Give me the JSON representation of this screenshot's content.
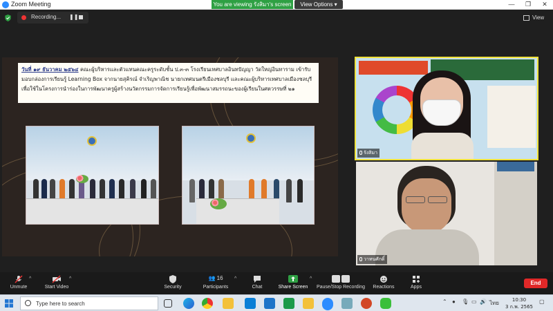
{
  "window": {
    "title": "Zoom Meeting",
    "viewing_banner": "You are viewing รังสิมา's screen",
    "view_options": "View Options",
    "minimize": "—",
    "maximize": "❐",
    "close": "✕"
  },
  "recording": {
    "label": "Recording...",
    "pause": "❚❚"
  },
  "view_button": "View",
  "slide": {
    "date": "วันที่ ๑๙ ธันวาคม ๒๕๖๔",
    "body": " คณะผู้บริหารและตัวแทนคณะครูระดับชั้น ป.๓-๓ โรงเรียนเทศบาลอินทปัญญา วัดใหญ่อินทาราม เข้ารับมอบกล่องการเรียนรู้ Learning Box จากนายสุคิรณ์ จำเริญพาณิช นายกเทศมนตรีเมืองชลบุรี และคณะผู้บริหารเทศบาลเมืองชลบุรี เพื่อใช้ในโครงการนำร่องในการพัฒนาครูผู้สร้างนวัตกรรมการจัดการเรียนรู้เพื่อพัฒนาสมรรถนะของผู้เรียนในศตวรรษที่ ๒๑"
  },
  "participants": [
    {
      "name": "รังสิมา"
    },
    {
      "name": "วาทนศักดิ์"
    }
  ],
  "toolbar": {
    "unmute": "Unmute",
    "start_video": "Start Video",
    "security": "Security",
    "participants": "Participants",
    "participant_count": "16",
    "chat": "Chat",
    "share_screen": "Share Screen",
    "pause_recording": "Pause/Stop Recording",
    "reactions": "Reactions",
    "apps": "Apps",
    "end": "End",
    "caret": "^"
  },
  "taskbar": {
    "search_placeholder": "Type here to search",
    "language": "ไทย",
    "time": "10:30",
    "date": "3 ก.พ. 2565"
  },
  "colors": {
    "banner_green": "#2ea043",
    "end_red": "#e02828",
    "active_speaker": "#f0e23a"
  }
}
